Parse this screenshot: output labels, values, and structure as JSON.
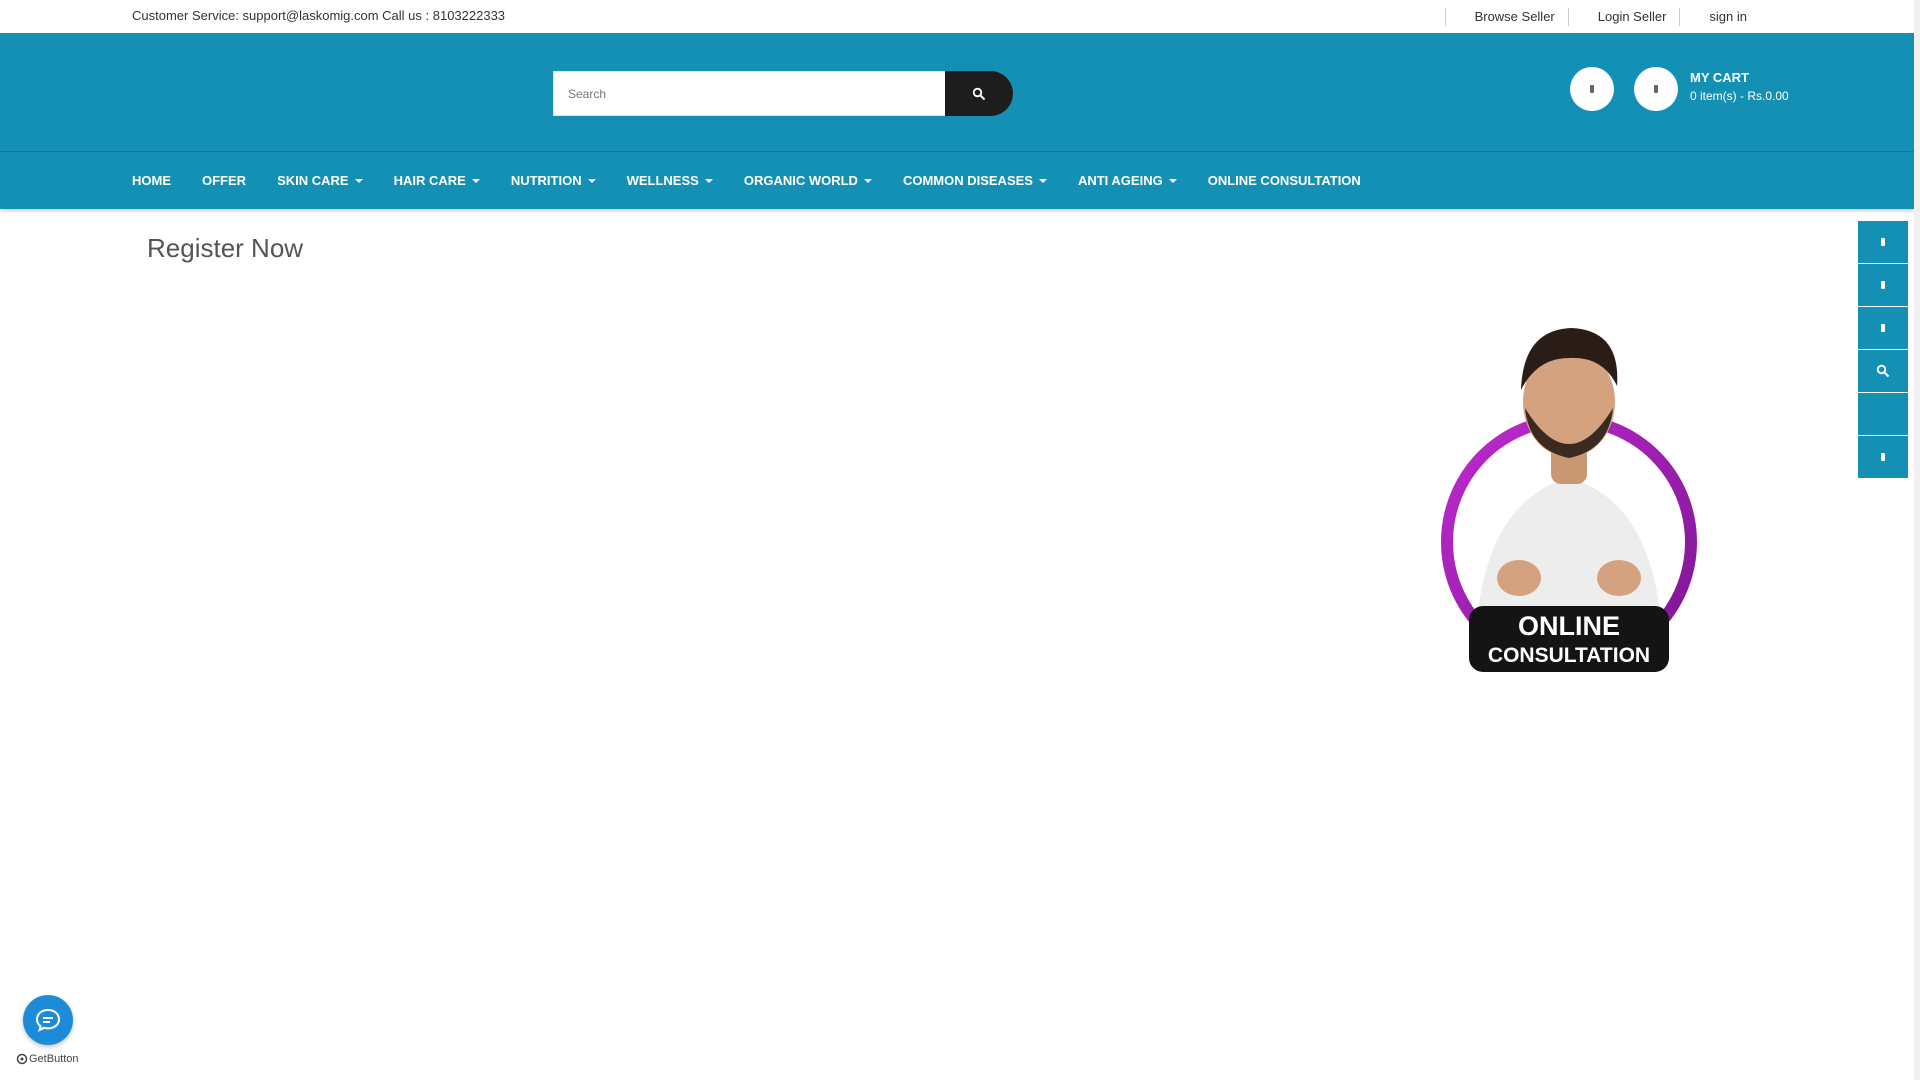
{
  "topbar": {
    "customer_service": "Customer Service: support@laskomig.com Call us : 8103222333",
    "links": [
      {
        "label": "Browse Seller"
      },
      {
        "label": "Login Seller"
      },
      {
        "label": "sign in"
      }
    ]
  },
  "search": {
    "placeholder": "Search",
    "icon": "search-icon"
  },
  "cart": {
    "title": "MY CART",
    "summary": "0 item(s) - Rs.0.00"
  },
  "nav": {
    "items": [
      {
        "label": "HOME",
        "dropdown": false
      },
      {
        "label": "OFFER",
        "dropdown": false
      },
      {
        "label": "SKIN CARE",
        "dropdown": true
      },
      {
        "label": "HAIR CARE",
        "dropdown": true
      },
      {
        "label": "NUTRITION",
        "dropdown": true
      },
      {
        "label": "WELLNESS",
        "dropdown": true
      },
      {
        "label": "ORGANIC WORLD",
        "dropdown": true
      },
      {
        "label": "COMMON DISEASES",
        "dropdown": true
      },
      {
        "label": "ANTI AGEING",
        "dropdown": true
      },
      {
        "label": "ONLINE CONSULTATION",
        "dropdown": false
      }
    ]
  },
  "main": {
    "title": "Register Now"
  },
  "promo": {
    "line1": "ONLINE",
    "line2": "CONSULTATION"
  },
  "getbutton": {
    "label": "GetButton"
  },
  "colors": {
    "header_bg": "#1590b5",
    "search_button": "#1d1d1d",
    "promo_ring": "#a01fb2",
    "getbutton": "#1e8bd8"
  }
}
